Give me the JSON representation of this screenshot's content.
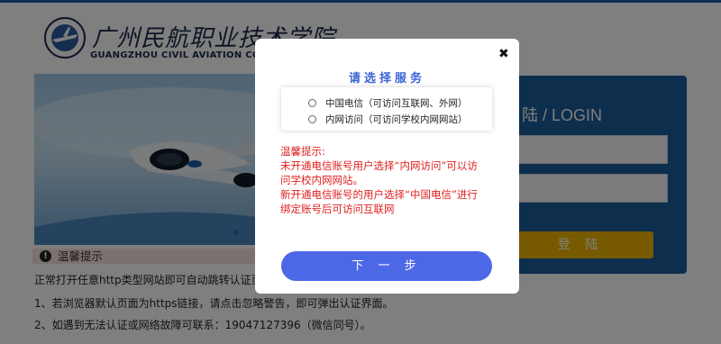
{
  "header": {
    "logo_cn": "广州民航职业技术学院",
    "logo_en": "GUANGZHOU CIVIL AVIATION COLLEGE"
  },
  "login": {
    "title": "陆 / LOGIN",
    "button": "登 陆"
  },
  "notice": {
    "icon": "!",
    "title": "温馨提示",
    "lines": [
      "正常打开任意http类型网站即可自动跳转认证页面，输",
      "1、若浏览器默认页面为https链接，请点击忽略警告，即可弹出认证界面。",
      "2、如遇到无法认证或网络故障可联系：19047127396（微信同号）。"
    ]
  },
  "modal": {
    "close": "✖",
    "title": "请选择服务",
    "options": [
      "中国电信（可访问互联网、外网）",
      "内网访问（可访问学校内网网站）"
    ],
    "warning": [
      "温馨提示:",
      "未开通电信账号用户选择“内网访问”可以访",
      "问学校内网网站。",
      "新开通电信账号的用户选择“中国电信”进行",
      "绑定账号后可访问互联网"
    ],
    "next": "下 一 步"
  }
}
